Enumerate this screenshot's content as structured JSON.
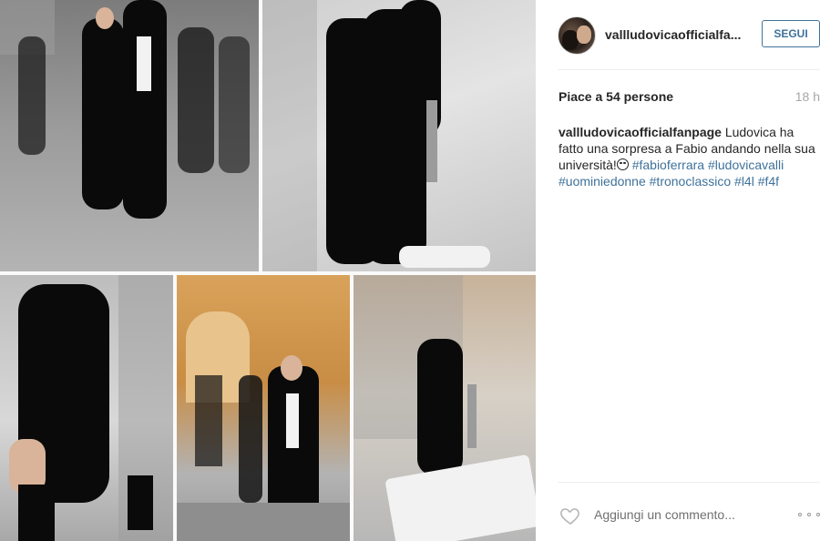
{
  "post": {
    "image_description_icon": "photo-collage"
  },
  "header": {
    "username": "vallludovicaofficialfa...",
    "follow_label": "SEGUI"
  },
  "stats": {
    "likes_text": "Piace a 54 persone",
    "time_ago": "18 h"
  },
  "caption": {
    "user": "vallludovicaofficialfanpage",
    "text": "Ludovica ha fatto una sorpresa a Fabio andando nella sua università!",
    "emoji_icon": "smile-emoji-icon",
    "tags": [
      "#fabioferrara",
      "#ludovicavalli",
      "#uominiedonne",
      "#tronoclassico",
      "#l4l",
      "#f4f"
    ]
  },
  "footer": {
    "heart_icon": "heart-icon",
    "comment_placeholder": "Aggiungi un commento...",
    "more_icon": "more-options-icon"
  },
  "colors": {
    "link": "#3f729b",
    "text": "#262626",
    "muted": "#a5a7aa",
    "divider": "#efefef"
  }
}
